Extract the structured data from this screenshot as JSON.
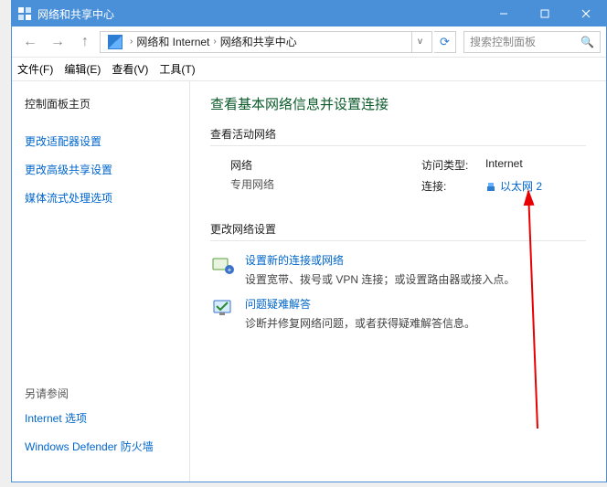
{
  "titlebar": {
    "title": "网络和共享中心"
  },
  "breadcrumb": {
    "item1": "网络和 Internet",
    "item2": "网络和共享中心",
    "search_placeholder": "搜索控制面板"
  },
  "menubar": {
    "file": "文件(F)",
    "edit": "编辑(E)",
    "view": "查看(V)",
    "tools": "工具(T)"
  },
  "sidebar": {
    "home": "控制面板主页",
    "adapter": "更改适配器设置",
    "sharing": "更改高级共享设置",
    "streaming": "媒体流式处理选项",
    "see_also": "另请参阅",
    "internet_options": "Internet 选项",
    "defender": "Windows Defender 防火墙"
  },
  "main": {
    "heading": "查看基本网络信息并设置连接",
    "active_section": "查看活动网络",
    "network_name": "网络",
    "network_type": "专用网络",
    "access_label": "访问类型:",
    "access_value": "Internet",
    "conn_label": "连接:",
    "conn_value": "以太网 2",
    "change_section": "更改网络设置",
    "task1_title": "设置新的连接或网络",
    "task1_desc": "设置宽带、拨号或 VPN 连接；或设置路由器或接入点。",
    "task2_title": "问题疑难解答",
    "task2_desc": "诊断并修复网络问题，或者获得疑难解答信息。"
  }
}
